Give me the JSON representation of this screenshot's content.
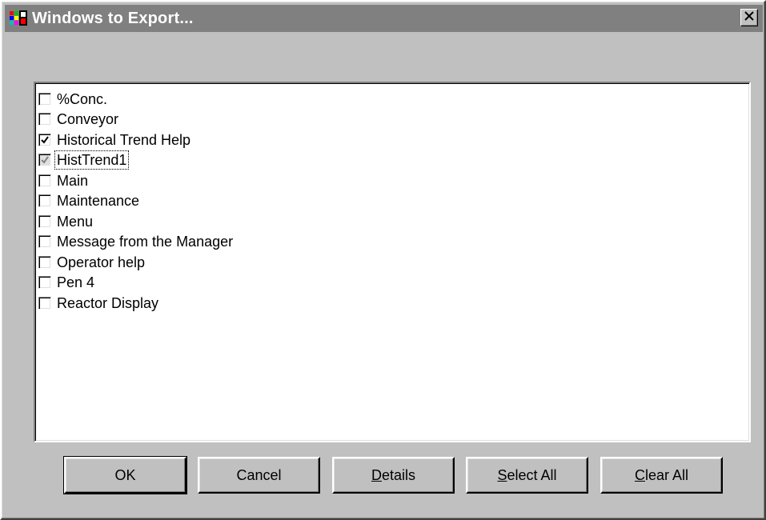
{
  "window": {
    "title": "Windows to Export...",
    "icon": "app-window-icon",
    "close_icon": "close-icon"
  },
  "list": {
    "items": [
      {
        "label": "%Conc.",
        "checked": false
      },
      {
        "label": "Conveyor",
        "checked": false
      },
      {
        "label": "Historical Trend Help",
        "checked": true
      },
      {
        "label": "HistTrend1",
        "checked": "indeterminate",
        "focused": true
      },
      {
        "label": "Main",
        "checked": false
      },
      {
        "label": "Maintenance",
        "checked": false
      },
      {
        "label": "Menu",
        "checked": false
      },
      {
        "label": "Message from the Manager",
        "checked": false
      },
      {
        "label": "Operator help",
        "checked": false
      },
      {
        "label": "Pen 4",
        "checked": false
      },
      {
        "label": "Reactor Display",
        "checked": false
      }
    ]
  },
  "buttons": {
    "ok": "OK",
    "cancel": "Cancel",
    "details_mnemonic": "D",
    "details_rest": "etails",
    "select_all_mnemonic": "S",
    "select_all_rest": "elect All",
    "clear_all_mnemonic": "C",
    "clear_all_rest": "lear All"
  }
}
